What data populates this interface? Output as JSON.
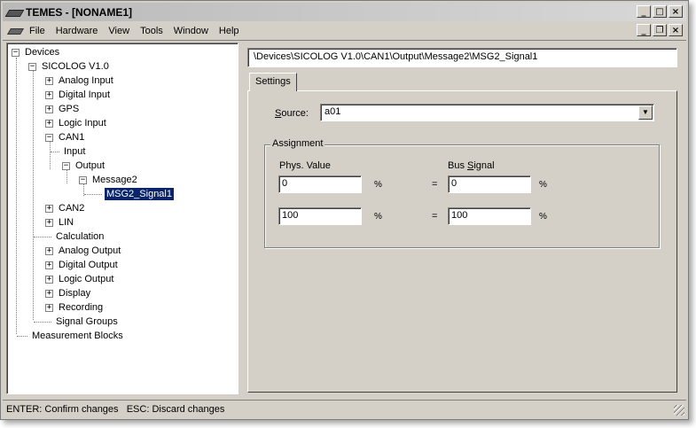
{
  "window": {
    "title": "TEMES - [NONAME1]"
  },
  "title_buttons": {
    "minimize": "_",
    "maximize": "□",
    "close": "×"
  },
  "mdi_buttons": {
    "minimize": "_",
    "restore": "❐",
    "close": "×"
  },
  "menu": [
    "File",
    "Hardware",
    "View",
    "Tools",
    "Window",
    "Help"
  ],
  "tree": [
    {
      "label": "Devices",
      "expander": "−"
    },
    {
      "label": "SICOLOG V1.0",
      "expander": "−"
    },
    {
      "label": "Analog Input",
      "expander": "+"
    },
    {
      "label": "Digital Input",
      "expander": "+"
    },
    {
      "label": "GPS",
      "expander": "+"
    },
    {
      "label": "Logic Input",
      "expander": "+"
    },
    {
      "label": "CAN1",
      "expander": "−"
    },
    {
      "label": "Input",
      "expander": ""
    },
    {
      "label": "Output",
      "expander": "−"
    },
    {
      "label": "Message2",
      "expander": "−"
    },
    {
      "label": "MSG2_Signal1",
      "expander": "",
      "selected": true
    },
    {
      "label": "CAN2",
      "expander": "+"
    },
    {
      "label": "LIN",
      "expander": "+"
    },
    {
      "label": "Calculation",
      "expander": ""
    },
    {
      "label": "Analog Output",
      "expander": "+"
    },
    {
      "label": "Digital Output",
      "expander": "+"
    },
    {
      "label": "Logic Output",
      "expander": "+"
    },
    {
      "label": "Display",
      "expander": "+"
    },
    {
      "label": "Recording",
      "expander": "+"
    },
    {
      "label": "Signal Groups",
      "expander": ""
    },
    {
      "label": "Measurement Blocks",
      "expander": ""
    }
  ],
  "path": "\\Devices\\SICOLOG V1.0\\CAN1\\Output\\Message2\\MSG2_Signal1",
  "tab": "Settings",
  "source": {
    "label_first": "S",
    "label_rest": "ource:",
    "value": "a01",
    "dropdown_arrow": "▼"
  },
  "assignment": {
    "title": "Assignment",
    "phys_label": "Phys. Value",
    "bus_label_pre": "Bus ",
    "bus_label_u": "S",
    "bus_label_post": "ignal",
    "rows": [
      {
        "phys": "0",
        "phys_unit": "%",
        "eq": "=",
        "bus": "0",
        "bus_unit": "%"
      },
      {
        "phys": "100",
        "phys_unit": "%",
        "eq": "=",
        "bus": "100",
        "bus_unit": "%"
      }
    ]
  },
  "status": "ENTER: Confirm changes   ESC: Discard changes"
}
